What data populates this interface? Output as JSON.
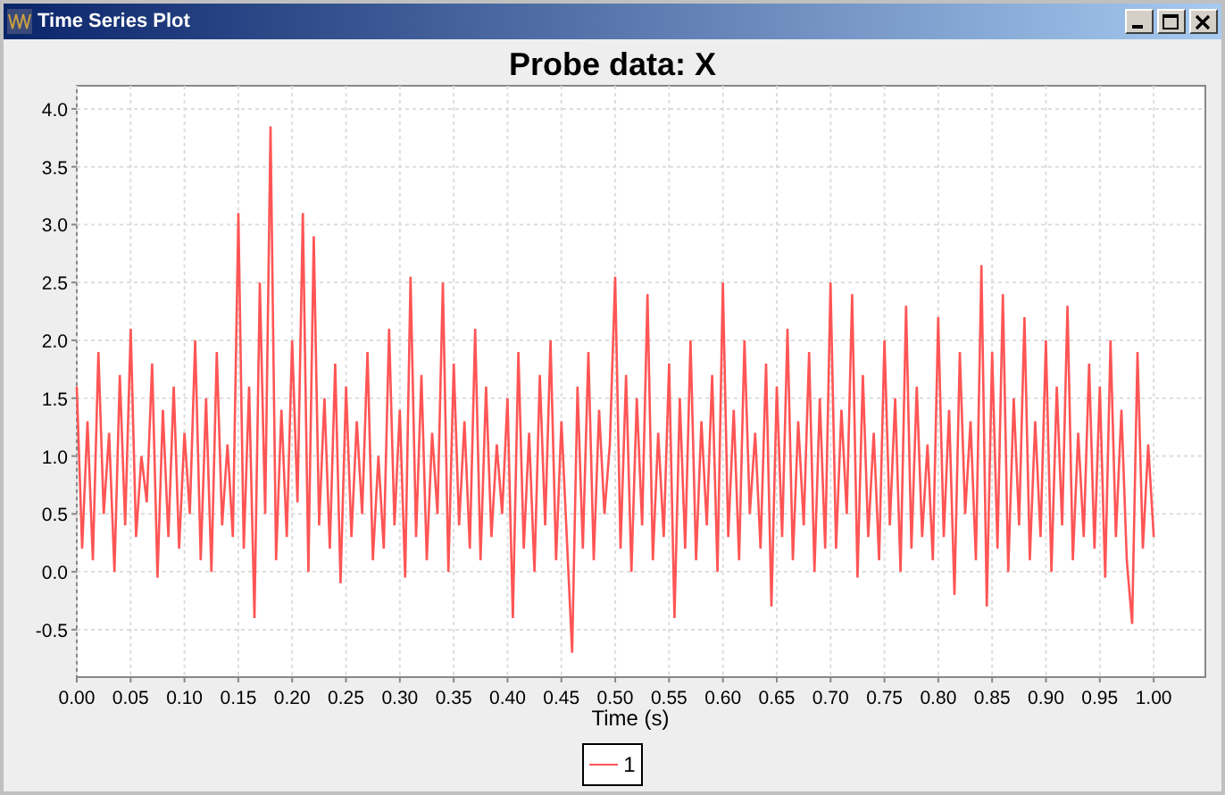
{
  "window": {
    "title": "Time Series Plot"
  },
  "chart": {
    "chart_data": {
      "type": "line",
      "grid": true,
      "title": "Probe data: X",
      "xlabel": "Time (s)",
      "xlim": [
        0,
        1.048
      ],
      "ylim": [
        -0.91,
        4.2
      ],
      "xticks": [
        {
          "value": 0,
          "label": "0.00"
        },
        {
          "value": 0.05,
          "label": "0.05"
        },
        {
          "value": 0.1,
          "label": "0.10"
        },
        {
          "value": 0.15,
          "label": "0.15"
        },
        {
          "value": 0.2,
          "label": "0.20"
        },
        {
          "value": 0.25,
          "label": "0.25"
        },
        {
          "value": 0.3,
          "label": "0.30"
        },
        {
          "value": 0.35,
          "label": "0.35"
        },
        {
          "value": 0.4,
          "label": "0.40"
        },
        {
          "value": 0.45,
          "label": "0.45"
        },
        {
          "value": 0.5,
          "label": "0.50"
        },
        {
          "value": 0.55,
          "label": "0.55"
        },
        {
          "value": 0.6,
          "label": "0.60"
        },
        {
          "value": 0.65,
          "label": "0.65"
        },
        {
          "value": 0.7,
          "label": "0.70"
        },
        {
          "value": 0.75,
          "label": "0.75"
        },
        {
          "value": 0.8,
          "label": "0.80"
        },
        {
          "value": 0.85,
          "label": "0.85"
        },
        {
          "value": 0.9,
          "label": "0.90"
        },
        {
          "value": 0.95,
          "label": "0.95"
        },
        {
          "value": 1,
          "label": "1.00"
        }
      ],
      "yticks": [
        {
          "value": -0.5,
          "label": "-0.5"
        },
        {
          "value": 0,
          "label": "0.0"
        },
        {
          "value": 0.5,
          "label": "0.5"
        },
        {
          "value": 1,
          "label": "1.0"
        },
        {
          "value": 1.5,
          "label": "1.5"
        },
        {
          "value": 2,
          "label": "2.0"
        },
        {
          "value": 2.5,
          "label": "2.5"
        },
        {
          "value": 3,
          "label": "3.0"
        },
        {
          "value": 3.5,
          "label": "3.5"
        },
        {
          "value": 4,
          "label": "4.0"
        }
      ],
      "x": [
        0,
        0.005,
        0.01,
        0.015,
        0.02,
        0.025,
        0.03,
        0.035,
        0.04,
        0.045,
        0.05,
        0.055,
        0.06,
        0.065,
        0.07,
        0.075,
        0.08,
        0.085,
        0.09,
        0.095,
        0.1,
        0.105,
        0.11,
        0.115,
        0.12,
        0.125,
        0.13,
        0.135,
        0.14,
        0.145,
        0.15,
        0.155,
        0.16,
        0.165,
        0.17,
        0.175,
        0.18,
        0.185,
        0.19,
        0.195,
        0.2,
        0.205,
        0.21,
        0.215,
        0.22,
        0.225,
        0.23,
        0.235,
        0.24,
        0.245,
        0.25,
        0.255,
        0.26,
        0.265,
        0.27,
        0.275,
        0.28,
        0.285,
        0.29,
        0.295,
        0.3,
        0.305,
        0.31,
        0.315,
        0.32,
        0.325,
        0.33,
        0.335,
        0.34,
        0.345,
        0.35,
        0.355,
        0.36,
        0.365,
        0.37,
        0.375,
        0.38,
        0.385,
        0.39,
        0.395,
        0.4,
        0.405,
        0.41,
        0.415,
        0.42,
        0.425,
        0.43,
        0.435,
        0.44,
        0.445,
        0.45,
        0.455,
        0.46,
        0.465,
        0.47,
        0.475,
        0.48,
        0.485,
        0.49,
        0.495,
        0.5,
        0.505,
        0.51,
        0.515,
        0.52,
        0.525,
        0.53,
        0.535,
        0.54,
        0.545,
        0.55,
        0.555,
        0.56,
        0.565,
        0.57,
        0.575,
        0.58,
        0.585,
        0.59,
        0.595,
        0.6,
        0.605,
        0.61,
        0.615,
        0.62,
        0.625,
        0.63,
        0.635,
        0.64,
        0.645,
        0.65,
        0.655,
        0.66,
        0.665,
        0.67,
        0.675,
        0.68,
        0.685,
        0.69,
        0.695,
        0.7,
        0.705,
        0.71,
        0.715,
        0.72,
        0.725,
        0.73,
        0.735,
        0.74,
        0.745,
        0.75,
        0.755,
        0.76,
        0.765,
        0.77,
        0.775,
        0.78,
        0.785,
        0.79,
        0.795,
        0.8,
        0.805,
        0.81,
        0.815,
        0.82,
        0.825,
        0.83,
        0.835,
        0.84,
        0.845,
        0.85,
        0.855,
        0.86,
        0.865,
        0.87,
        0.875,
        0.88,
        0.885,
        0.89,
        0.895,
        0.9,
        0.905,
        0.91,
        0.915,
        0.92,
        0.925,
        0.93,
        0.935,
        0.94,
        0.945,
        0.95,
        0.955,
        0.96,
        0.965,
        0.97,
        0.975,
        0.98,
        0.985,
        0.99,
        0.995,
        1
      ],
      "series": [
        {
          "name": "1",
          "color": "#ff5555",
          "values": [
            1.6,
            0.2,
            1.3,
            0.1,
            1.9,
            0.5,
            1.2,
            0.0,
            1.7,
            0.4,
            2.1,
            0.3,
            1.0,
            0.6,
            1.8,
            -0.05,
            1.4,
            0.3,
            1.6,
            0.2,
            1.2,
            0.5,
            2.0,
            0.1,
            1.5,
            0.0,
            1.9,
            0.4,
            1.1,
            0.3,
            3.1,
            0.2,
            1.6,
            -0.4,
            2.5,
            0.5,
            3.85,
            0.1,
            1.4,
            0.3,
            2.0,
            0.6,
            3.1,
            0.0,
            2.9,
            0.4,
            1.5,
            0.2,
            1.8,
            -0.1,
            1.6,
            0.3,
            1.3,
            0.5,
            1.9,
            0.1,
            1.0,
            0.2,
            2.1,
            0.4,
            1.4,
            -0.05,
            2.55,
            0.3,
            1.7,
            0.1,
            1.2,
            0.5,
            2.5,
            0.0,
            1.8,
            0.4,
            1.3,
            0.2,
            2.1,
            0.1,
            1.6,
            0.3,
            1.1,
            0.5,
            1.5,
            -0.4,
            1.9,
            0.2,
            1.2,
            0.0,
            1.7,
            0.4,
            2.0,
            0.1,
            1.3,
            0.3,
            -0.7,
            1.6,
            0.2,
            1.9,
            0.1,
            1.4,
            0.5,
            1.1,
            2.55,
            0.2,
            1.7,
            0.0,
            1.5,
            0.4,
            2.4,
            0.1,
            1.2,
            0.3,
            1.8,
            -0.4,
            1.5,
            0.2,
            2.0,
            0.1,
            1.3,
            0.4,
            1.7,
            0.0,
            2.5,
            0.3,
            1.4,
            0.1,
            2.0,
            0.5,
            1.2,
            0.2,
            1.8,
            -0.3,
            1.6,
            0.3,
            2.1,
            0.1,
            1.3,
            0.4,
            1.9,
            0.0,
            1.5,
            0.2,
            2.5,
            0.2,
            1.4,
            0.5,
            2.4,
            -0.05,
            1.7,
            0.3,
            1.2,
            0.1,
            2.0,
            0.4,
            1.5,
            0.0,
            2.3,
            0.2,
            1.6,
            0.3,
            1.1,
            0.1,
            2.2,
            0.3,
            1.4,
            -0.2,
            1.9,
            0.5,
            1.3,
            0.1,
            2.65,
            -0.3,
            1.9,
            0.2,
            2.4,
            0.0,
            1.5,
            0.4,
            2.2,
            0.1,
            1.3,
            0.3,
            2.0,
            0.0,
            1.6,
            0.4,
            2.3,
            0.1,
            1.2,
            0.3,
            1.8,
            0.2,
            1.6,
            -0.05,
            2.0,
            0.3,
            1.4,
            0.1,
            -0.45,
            1.9,
            0.2,
            1.1,
            0.3
          ]
        }
      ]
    }
  }
}
